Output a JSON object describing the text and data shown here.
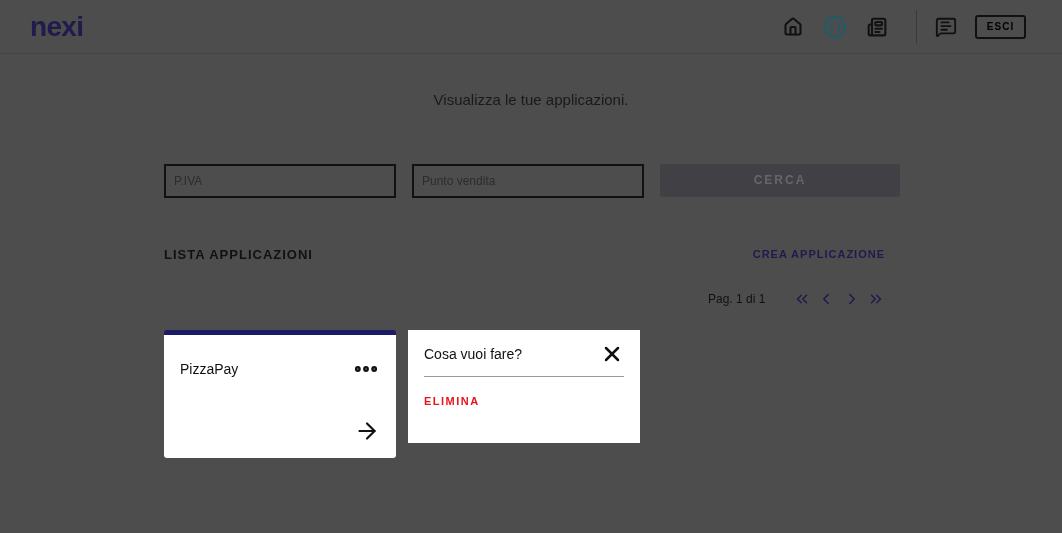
{
  "header": {
    "logo": "nexi",
    "nav": [
      {
        "kind": "home",
        "selected": false
      },
      {
        "kind": "code",
        "selected": true
      },
      {
        "kind": "docs",
        "selected": false
      }
    ],
    "logout": "ESCI"
  },
  "title": "Visualizza le tue applicazioni.",
  "search": {
    "fields": [
      {
        "placeholder": "P.IVA"
      },
      {
        "placeholder": "Punto vendita"
      }
    ],
    "button": {
      "label": "CERCA",
      "disabled": true
    }
  },
  "list": {
    "heading": "LISTA APPLICAZIONI",
    "create": "CREA APPLICAZIONE",
    "pagination": "Pag. 1 di 1"
  },
  "apps": [
    {
      "name": "PizzaPay"
    }
  ],
  "menu": {
    "title": "Cosa vuoi fare?",
    "actions": [
      "ELIMINA"
    ]
  }
}
